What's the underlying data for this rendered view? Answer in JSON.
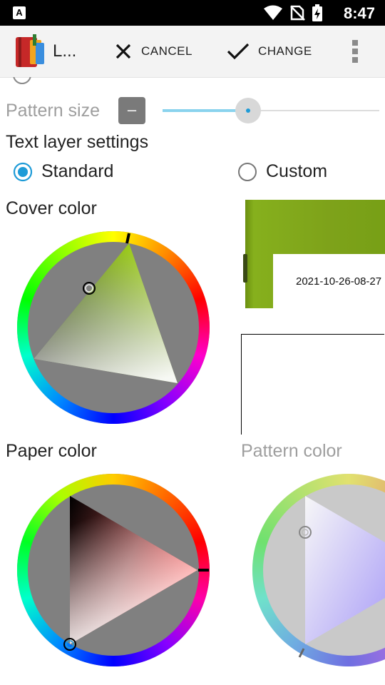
{
  "status_bar": {
    "time": "8:47",
    "notification_badge": "A"
  },
  "app_bar": {
    "title": "L...",
    "cancel_label": "CANCEL",
    "change_label": "CHANGE"
  },
  "settings": {
    "pattern_size_label": "Pattern size",
    "pattern_size_minus": "–",
    "pattern_size_value": 0.88,
    "text_layer_heading": "Text layer settings",
    "radio_standard": "Standard",
    "radio_custom": "Custom",
    "radio_selected": "Standard",
    "cover_color_label": "Cover color",
    "paper_color_label": "Paper color",
    "pattern_color_label": "Pattern color"
  },
  "preview": {
    "book_title": "2021-10-26-08-27"
  },
  "colors": {
    "accent": "#1e9bd7",
    "cover": "#7ba21a",
    "slider_track": "#8ad3ee",
    "text_gray": "#9e9e9e"
  }
}
